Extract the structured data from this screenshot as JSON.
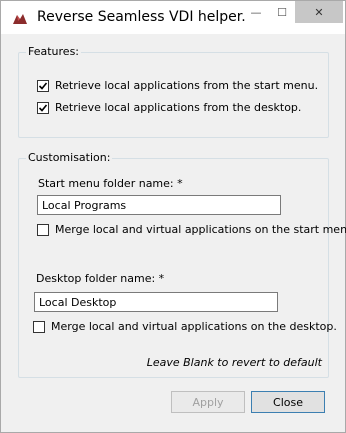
{
  "window": {
    "title": "Reverse Seamless VDI helper.",
    "minimize_glyph": "—",
    "maximize_glyph": "☐",
    "close_glyph": "✕"
  },
  "features": {
    "legend": "Features:",
    "items": [
      {
        "label": "Retrieve local applications from the start menu.",
        "checked": true
      },
      {
        "label": "Retrieve local applications from the desktop.",
        "checked": true
      }
    ]
  },
  "customisation": {
    "legend": "Customisation:",
    "start_menu": {
      "label": "Start menu folder name: *",
      "value": "Local Programs",
      "merge_label": "Merge local and virtual applications on the start menu.",
      "merge_checked": false
    },
    "desktop": {
      "label": "Desktop folder name: *",
      "value": "Local Desktop",
      "merge_label": "Merge local and virtual applications on the desktop.",
      "merge_checked": false
    },
    "hint": "Leave Blank to revert to default"
  },
  "buttons": {
    "apply": "Apply",
    "close": "Close"
  },
  "icons": {
    "app": "app-icon",
    "check": "check-icon"
  }
}
